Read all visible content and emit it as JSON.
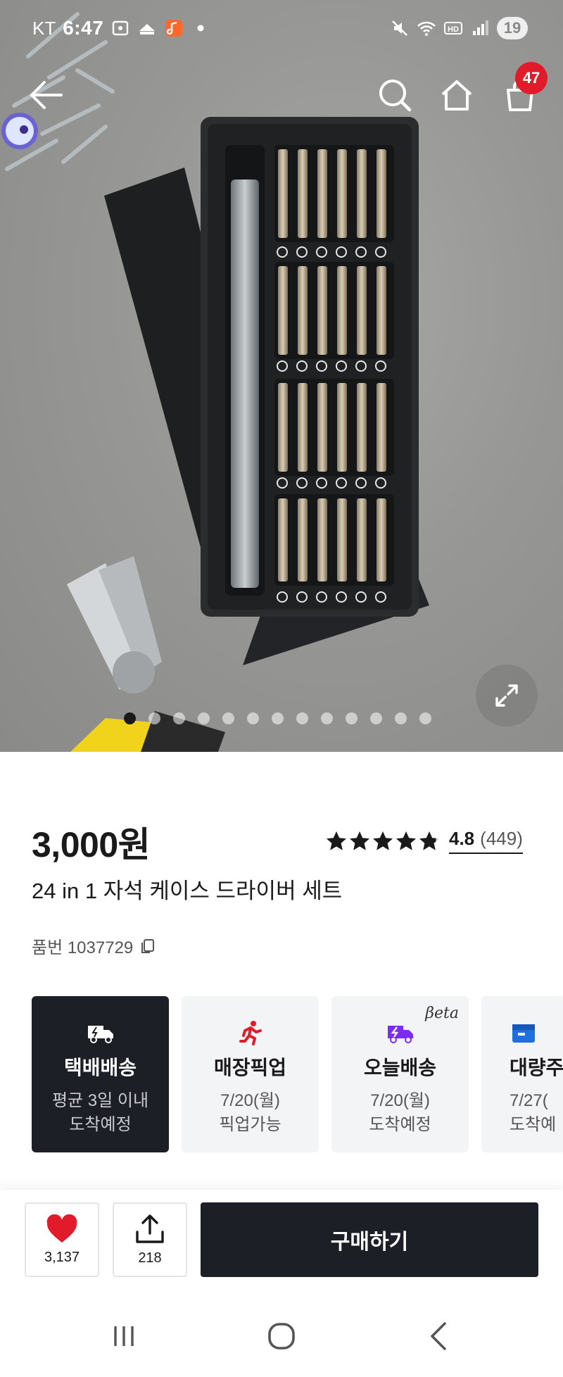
{
  "status_bar": {
    "carrier": "KT",
    "time": "6:47",
    "battery": "19"
  },
  "nav": {
    "cart_count": "47"
  },
  "gallery": {
    "total_images": 13,
    "active_index": 0
  },
  "product": {
    "price": "3,000원",
    "title": "24 in 1 자석 케이스 드라이버 세트",
    "sku_label": "품번 1037729",
    "rating": {
      "stars": 4.8,
      "score": "4.8",
      "count": "(449)"
    }
  },
  "delivery_options": [
    {
      "title": "택배배송",
      "line1": "평균 3일 이내",
      "line2": "도착예정",
      "icon": "delivery-truck-icon",
      "icon_color": "#ffffff",
      "selected": true
    },
    {
      "title": "매장픽업",
      "line1": "7/20(월)",
      "line2": "픽업가능",
      "icon": "running-person-icon",
      "icon_color": "#e21b2b",
      "selected": false
    },
    {
      "title": "오늘배송",
      "line1": "7/20(월)",
      "line2": "도착예정",
      "icon": "fast-truck-icon",
      "icon_color": "#7b2cf0",
      "selected": false,
      "badge": "βeta"
    },
    {
      "title": "대량주",
      "line1": "7/27(",
      "line2": "도착예",
      "icon": "box-icon",
      "icon_color": "#1f6fe0",
      "selected": false
    }
  ],
  "actions": {
    "like_count": "3,137",
    "share_count": "218",
    "buy_label": "구매하기"
  },
  "colors": {
    "primary_dark": "#1c1f26",
    "badge_red": "#e21b2b",
    "heart_red": "#e21b2b"
  }
}
